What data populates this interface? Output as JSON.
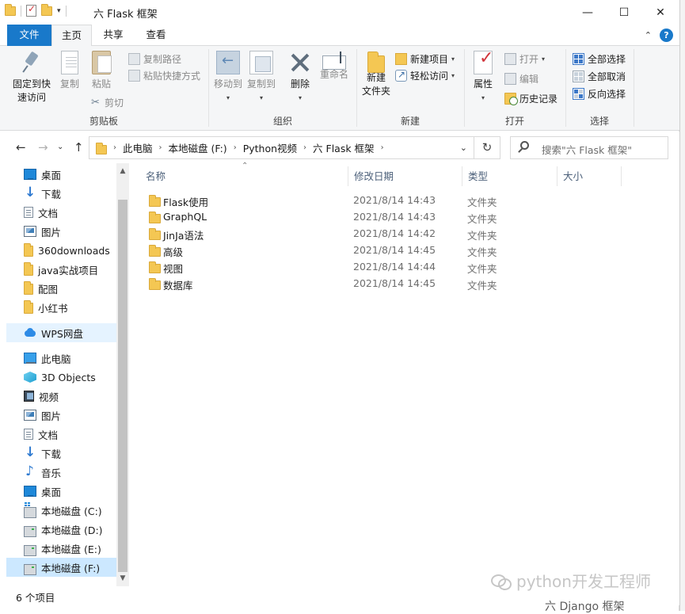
{
  "titlebar": {
    "title": "六 Flask 框架",
    "minimize_glyph": "—",
    "maximize_glyph": "☐",
    "close_glyph": "✕"
  },
  "tabs": {
    "file": "文件",
    "home": "主页",
    "share": "共享",
    "view": "查看"
  },
  "ribbon": {
    "clipboard": {
      "label": "剪贴板",
      "pin": "固定到快\n速访问",
      "pin_line1": "固定到快",
      "pin_line2": "速访问",
      "copy": "复制",
      "paste": "粘贴",
      "copy_path": "复制路径",
      "paste_shortcut": "粘贴快捷方式",
      "cut": "剪切"
    },
    "organize": {
      "label": "组织",
      "move_to": "移动到",
      "copy_to": "复制到",
      "delete": "删除",
      "rename": "重命名"
    },
    "new": {
      "label": "新建",
      "new_folder_line1": "新建",
      "new_folder_line2": "文件夹",
      "new_item": "新建项目",
      "easy_access": "轻松访问"
    },
    "open": {
      "label": "打开",
      "properties": "属性",
      "open": "打开",
      "edit": "编辑",
      "history": "历史记录"
    },
    "select": {
      "label": "选择",
      "select_all": "全部选择",
      "select_none": "全部取消",
      "invert": "反向选择"
    }
  },
  "address": {
    "crumbs": [
      "此电脑",
      "本地磁盘 (F:)",
      "Python视频",
      "六 Flask 框架"
    ],
    "search_placeholder": "搜索\"六 Flask 框架\""
  },
  "navpane": {
    "quick_access": [
      {
        "label": "桌面",
        "icon": "desktop-icon",
        "pinned": true
      },
      {
        "label": "下载",
        "icon": "download-icon",
        "pinned": true
      },
      {
        "label": "文档",
        "icon": "documents-icon",
        "pinned": true
      },
      {
        "label": "图片",
        "icon": "pictures-icon",
        "pinned": true
      },
      {
        "label": "360downloads",
        "icon": "folder-icon",
        "pinned": false
      },
      {
        "label": "java实战项目",
        "icon": "folder-icon",
        "pinned": false
      },
      {
        "label": "配图",
        "icon": "folder-icon",
        "pinned": false
      },
      {
        "label": "小红书",
        "icon": "folder-icon",
        "pinned": false
      }
    ],
    "wps": "WPS网盘",
    "this_pc": "此电脑",
    "pc_items": [
      {
        "label": "3D Objects",
        "icon": "3d-objects-icon"
      },
      {
        "label": "视频",
        "icon": "videos-icon"
      },
      {
        "label": "图片",
        "icon": "pictures-icon"
      },
      {
        "label": "文档",
        "icon": "documents-icon"
      },
      {
        "label": "下载",
        "icon": "download-icon"
      },
      {
        "label": "音乐",
        "icon": "music-icon"
      },
      {
        "label": "桌面",
        "icon": "desktop-icon"
      },
      {
        "label": "本地磁盘 (C:)",
        "icon": "drive-c-icon"
      },
      {
        "label": "本地磁盘 (D:)",
        "icon": "drive-icon"
      },
      {
        "label": "本地磁盘 (E:)",
        "icon": "drive-icon"
      },
      {
        "label": "本地磁盘 (F:)",
        "icon": "drive-icon",
        "selected": true
      }
    ]
  },
  "filelist": {
    "columns": {
      "name": "名称",
      "modified": "修改日期",
      "type": "类型",
      "size": "大小"
    },
    "rows": [
      {
        "name": "Flask使用",
        "modified": "2021/8/14 14:43",
        "type": "文件夹"
      },
      {
        "name": "GraphQL",
        "modified": "2021/8/14 14:43",
        "type": "文件夹"
      },
      {
        "name": "JinJa语法",
        "modified": "2021/8/14 14:42",
        "type": "文件夹"
      },
      {
        "name": "高级",
        "modified": "2021/8/14 14:45",
        "type": "文件夹"
      },
      {
        "name": "视图",
        "modified": "2021/8/14 14:44",
        "type": "文件夹"
      },
      {
        "name": "数据库",
        "modified": "2021/8/14 14:45",
        "type": "文件夹"
      }
    ]
  },
  "status": {
    "count": "6 个项目"
  },
  "watermark": "python开发工程师",
  "bottom_peek": "六 Django 框架",
  "colors": {
    "accent": "#1979ca",
    "selection": "#cce8ff",
    "folder": "#f4c753"
  }
}
